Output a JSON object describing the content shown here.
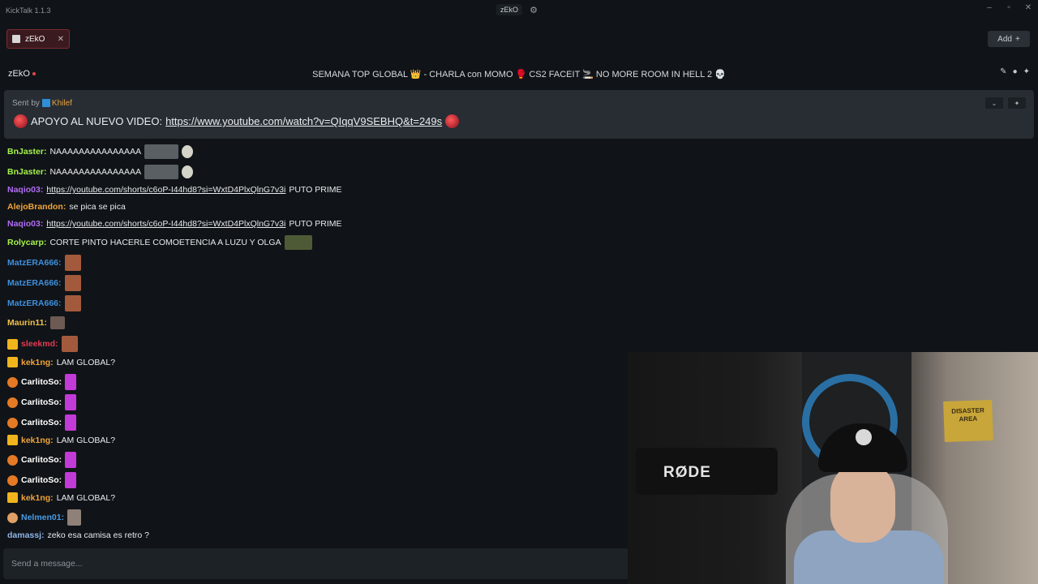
{
  "window": {
    "app_title": "KickTalk 1.1.3",
    "center_chip": "zEkO"
  },
  "tabs": [
    {
      "label": "zEkO"
    }
  ],
  "toolbar": {
    "add_label": "Add"
  },
  "channel": {
    "name": "zEkO",
    "stream_title": "SEMANA TOP GLOBAL 👑 - CHARLA con MOMO 🥊 CS2 FACEIT 🚬 NO MORE ROOM IN HELL 2 💀"
  },
  "pinned": {
    "sent_by_label": "Sent by",
    "sender": "Khilef",
    "message_prefix": "APOYO AL NUEVO VIDEO:",
    "link": "https://www.youtube.com/watch?v=QIqqV9SEBHQ&t=249s"
  },
  "messages": [
    {
      "user": "BnJaster:",
      "color": "#a6f24b",
      "text": "NAAAAAAAAAAAAAAA"
    },
    {
      "user": "BnJaster:",
      "color": "#a6f24b",
      "text": "NAAAAAAAAAAAAAAA"
    },
    {
      "user": "Naqio03:",
      "color": "#b06cf3",
      "link": "https://youtube.com/shorts/c6oP-I44hd8?si=WxtD4PlxQlnG7v3i",
      "text": "PUTO PRIME"
    },
    {
      "user": "AlejoBrandon:",
      "color": "#f0a43a",
      "text": "se pica se pica"
    },
    {
      "user": "Naqio03:",
      "color": "#b06cf3",
      "link": "https://youtube.com/shorts/c6oP-I44hd8?si=WxtD4PlxQlnG7v3i",
      "text": "PUTO PRIME"
    },
    {
      "user": "Rolycarp:",
      "color": "#a6f24b",
      "text": "CORTE PINTO HACERLE COMOETENCIA A LUZU Y OLGA"
    },
    {
      "user": "MatzERA666:",
      "color": "#3f8fdc",
      "text": ""
    },
    {
      "user": "MatzERA666:",
      "color": "#3f8fdc",
      "text": ""
    },
    {
      "user": "MatzERA666:",
      "color": "#3f8fdc",
      "text": ""
    },
    {
      "user": "Maurin11:",
      "color": "#f2c14a",
      "text": ""
    },
    {
      "user": "sleekmd:",
      "color": "#e23a52",
      "text": ""
    },
    {
      "user": "kek1ng:",
      "color": "#f0a43a",
      "text": "LAM GLOBAL?"
    },
    {
      "user": "CarlitoSo:",
      "color": "#ffffff",
      "text": ""
    },
    {
      "user": "CarlitoSo:",
      "color": "#ffffff",
      "text": ""
    },
    {
      "user": "CarlitoSo:",
      "color": "#ffffff",
      "text": ""
    },
    {
      "user": "kek1ng:",
      "color": "#f0a43a",
      "text": "LAM GLOBAL?"
    },
    {
      "user": "CarlitoSo:",
      "color": "#ffffff",
      "text": ""
    },
    {
      "user": "CarlitoSo:",
      "color": "#ffffff",
      "text": ""
    },
    {
      "user": "kek1ng:",
      "color": "#f0a43a",
      "text": "LAM GLOBAL?"
    },
    {
      "user": "Nelmen01:",
      "color": "#4a9be3",
      "text": ""
    },
    {
      "user": "damassj:",
      "color": "#8fb4e6",
      "text": "zeko esa camisa es retro ?"
    }
  ],
  "composer": {
    "placeholder": "Send a message..."
  },
  "webcam": {
    "mic_brand": "RØDE",
    "poster_text": "DISASTER AREA"
  }
}
